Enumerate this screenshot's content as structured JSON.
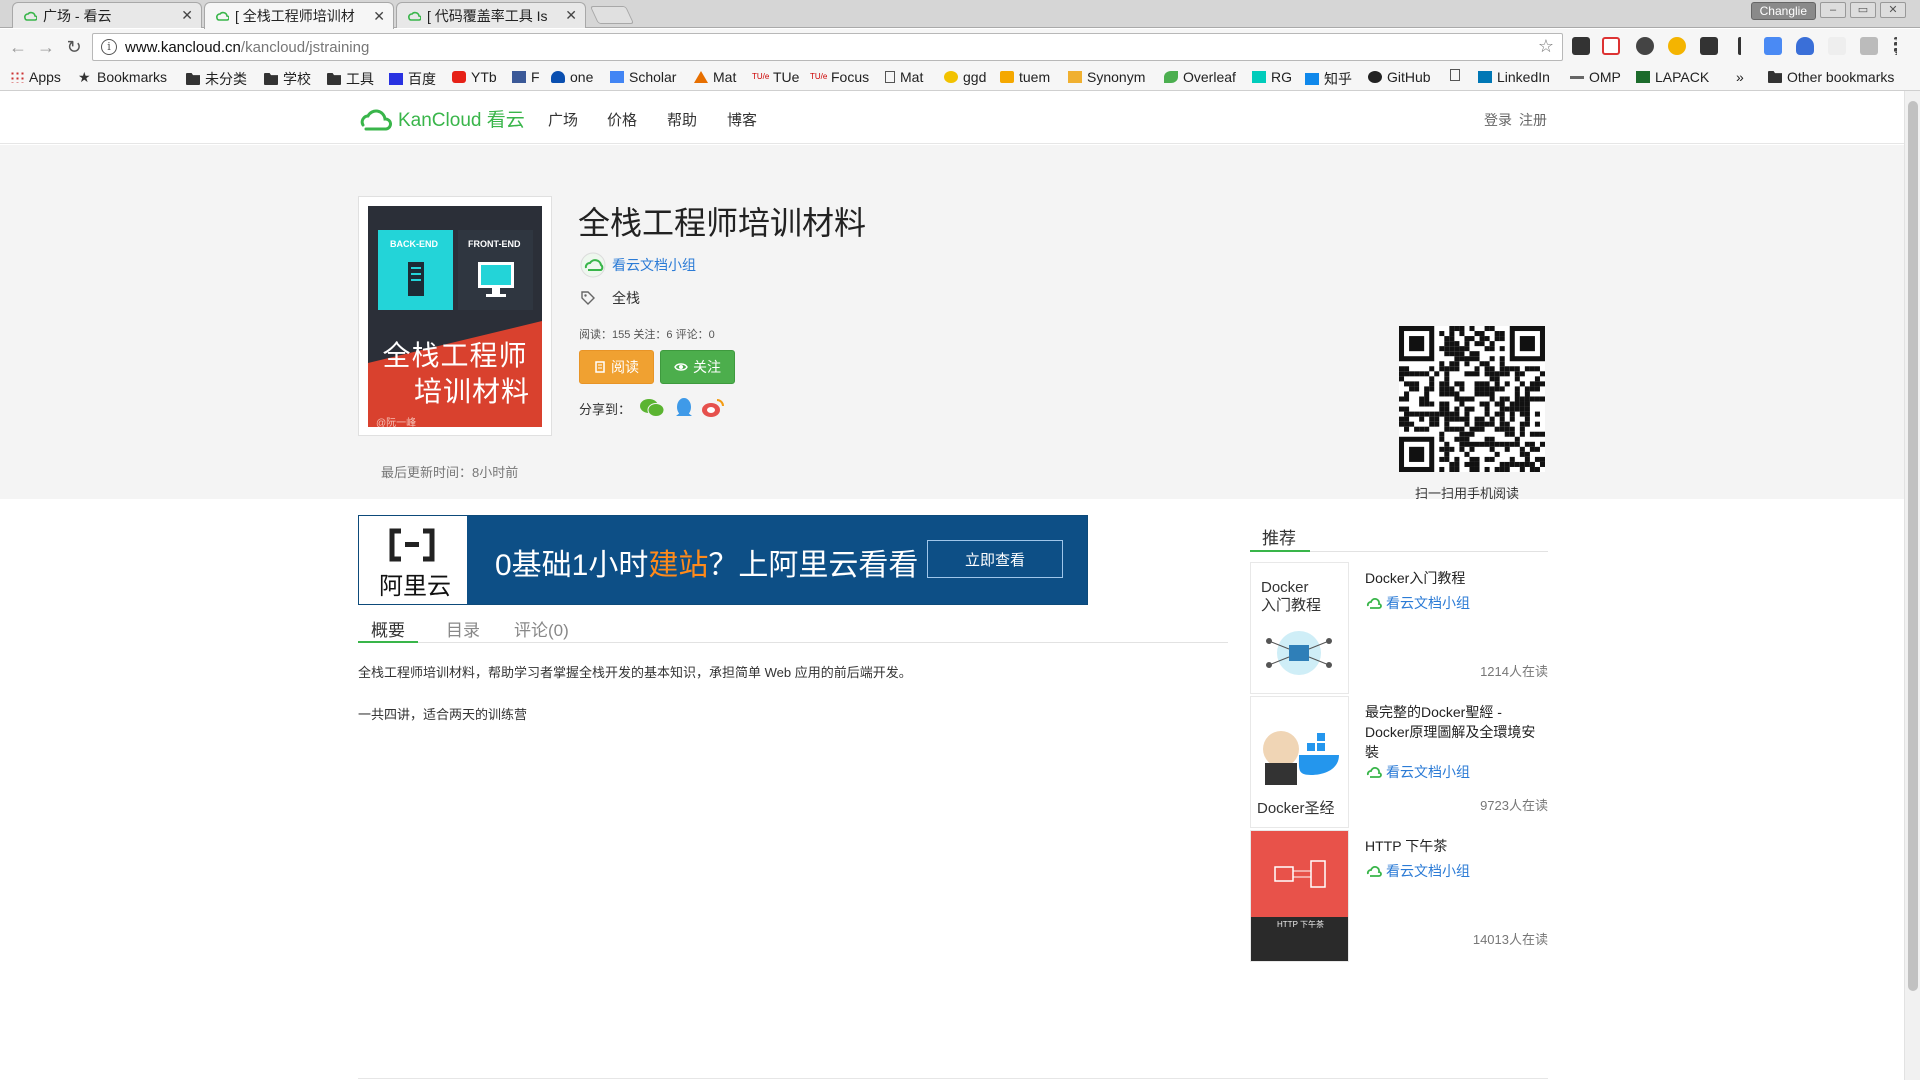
{
  "browser": {
    "tabs": [
      {
        "title": "广场 - 看云",
        "active": false
      },
      {
        "title": "[ 全栈工程师培训材",
        "active": true
      },
      {
        "title": "[ 代码覆盖率工具 Is",
        "active": false
      }
    ],
    "profile": "Changlie",
    "url_host": "www.kancloud.cn",
    "url_path": "/kancloud/jstraining",
    "bookmarks": [
      "Apps",
      "Bookmarks",
      "未分类",
      "学校",
      "工具",
      "百度",
      "YTb",
      "F",
      "one",
      "Scholar",
      "Mat",
      "TUe",
      "Focus",
      "Mat",
      "ggd",
      "tuem",
      "Synonym",
      "Overleaf",
      "RG",
      "知乎",
      "GitHub",
      "LinkedIn",
      "OMP",
      "LAPACK"
    ],
    "bookmarks_more": "»",
    "other_bookmarks": "Other bookmarks"
  },
  "site": {
    "logo_text": "KanCloud 看云",
    "nav": [
      "广场",
      "价格",
      "帮助",
      "博客"
    ],
    "login": "登录",
    "register": "注册"
  },
  "book": {
    "cover": {
      "panel_left": "BACK-END",
      "panel_right": "FRONT-END",
      "line1": "全栈工程师",
      "line2": "培训材料",
      "author_mark": "@阮一峰"
    },
    "title": "全栈工程师培训材料",
    "author": "看云文档小组",
    "tag": "全栈",
    "stats": "阅读：155 关注：6 评论：0",
    "read_btn": "阅读",
    "follow_btn": "关注",
    "share_label": "分享到：",
    "updated": "最后更新时间：8小时前",
    "qr_caption": "扫一扫用手机阅读"
  },
  "ad": {
    "brand": "阿里云",
    "slogan_pre": "0基础1小时",
    "slogan_hl": "建站",
    "slogan_post": "？上阿里云看看",
    "cta": "立即查看"
  },
  "content_tabs": [
    "概要",
    "目录",
    "评论(0)"
  ],
  "description": [
    "全栈工程师培训材料，帮助学习者掌握全栈开发的基本知识，承担简单 Web 应用的前后端开发。",
    "一共四讲，适合两天的训练营"
  ],
  "recommend": {
    "title": "推荐",
    "items": [
      {
        "title": "Docker入门教程",
        "author": "看云文档小组",
        "count": "1214人在读",
        "cover_text": "Docker\n入门教程"
      },
      {
        "title": "最完整的Docker聖經 - Docker原理圖解及全環境安裝",
        "author": "看云文档小组",
        "count": "9723人在读",
        "cover_text": "Docker圣经"
      },
      {
        "title": "HTTP 下午茶",
        "author": "看云文档小组",
        "count": "14013人在读",
        "cover_text": "HTTP 下午茶"
      }
    ]
  },
  "colors": {
    "brand_green": "#39b54a",
    "link_blue": "#2b7bd6",
    "read_orange": "#f0a131",
    "follow_green": "#4cae4c",
    "ad_blue": "#0d4f86"
  }
}
